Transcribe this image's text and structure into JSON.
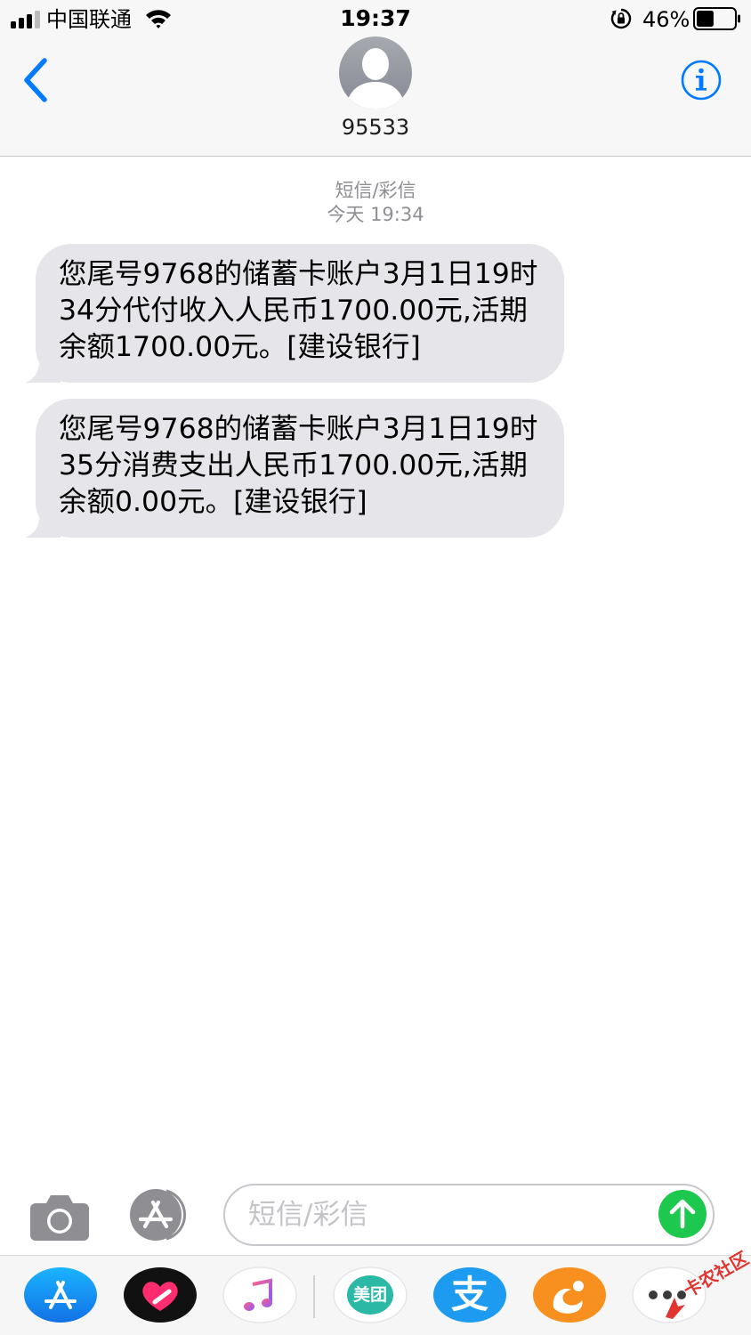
{
  "status_bar": {
    "carrier": "中国联通",
    "time": "19:37",
    "battery_percent": "46%",
    "battery_level": 0.46
  },
  "header": {
    "contact_name": "95533"
  },
  "conversation": {
    "service_label": "短信/彩信",
    "timestamp": "今天 19:34",
    "messages": [
      {
        "text": "您尾号9768的储蓄卡账户3月1日19时34分代付收入人民币1700.00元,活期余额1700.00元。[建设银行]"
      },
      {
        "text": "您尾号9768的储蓄卡账户3月1日19时35分消费支出人民币1700.00元,活期余额0.00元。[建设银行]"
      }
    ]
  },
  "composer": {
    "placeholder": "短信/彩信"
  },
  "app_drawer": {
    "apps": [
      {
        "icon": "app-store-icon"
      },
      {
        "icon": "digital-touch-heart-icon"
      },
      {
        "icon": "music-icon"
      },
      {
        "label": "美团",
        "icon": "meituan-icon"
      },
      {
        "label": "支",
        "icon": "alipay-icon"
      },
      {
        "icon": "uc-browser-icon"
      },
      {
        "icon": "more-icon"
      }
    ]
  },
  "watermark": {
    "text": "卡农社区"
  },
  "colors": {
    "ios_blue": "#007aff",
    "bubble_gray": "#e5e5ea",
    "send_green": "#34c759",
    "meta_gray": "#8e8e93"
  }
}
